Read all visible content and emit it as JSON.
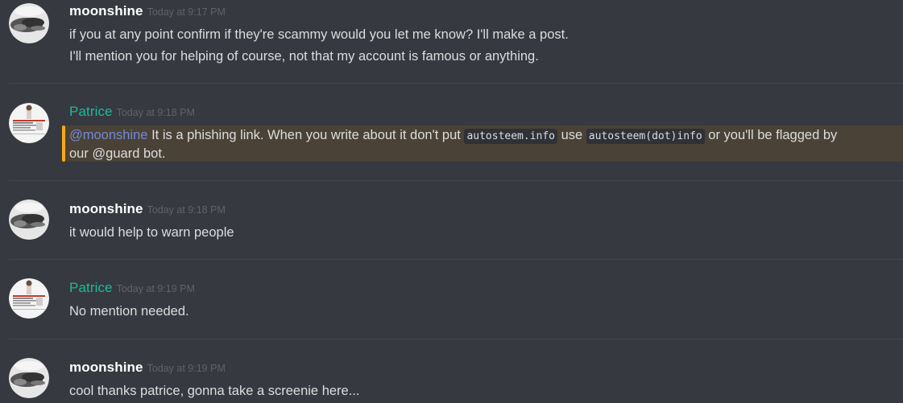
{
  "messages": [
    {
      "author": "moonshine",
      "timestamp": "Today at 9:17 PM",
      "lines": [
        "if you at any point confirm if they're scammy would you let me know? I'll make a post.",
        "I'll mention you for helping of course, not that my account is famous or anything."
      ]
    },
    {
      "author": "Patrice",
      "timestamp": "Today at 9:18 PM",
      "mention": "@moonshine",
      "text_1": " It is a phishing link. When you write about it don't put ",
      "code_1": "autosteem.info",
      "text_2": " use ",
      "code_2": "autosteem(dot)info",
      "text_3": " or you'll be flagged by",
      "line_2": "our @guard bot."
    },
    {
      "author": "moonshine",
      "timestamp": "Today at 9:18 PM",
      "lines": [
        "it would help to warn people"
      ]
    },
    {
      "author": "Patrice",
      "timestamp": "Today at 9:19 PM",
      "lines": [
        "No mention needed."
      ]
    },
    {
      "author": "moonshine",
      "timestamp": "Today at 9:19 PM",
      "lines": [
        "cool thanks patrice, gonna take a screenie here..."
      ]
    }
  ],
  "colors": {
    "background": "#36393f",
    "patrice_name": "#1abc9c",
    "mention": "#7289da",
    "highlight_bar": "#faa61a"
  },
  "icons": {
    "moonshine_avatar": "moon-avatar-icon",
    "patrice_avatar": "patrice-avatar-icon"
  }
}
